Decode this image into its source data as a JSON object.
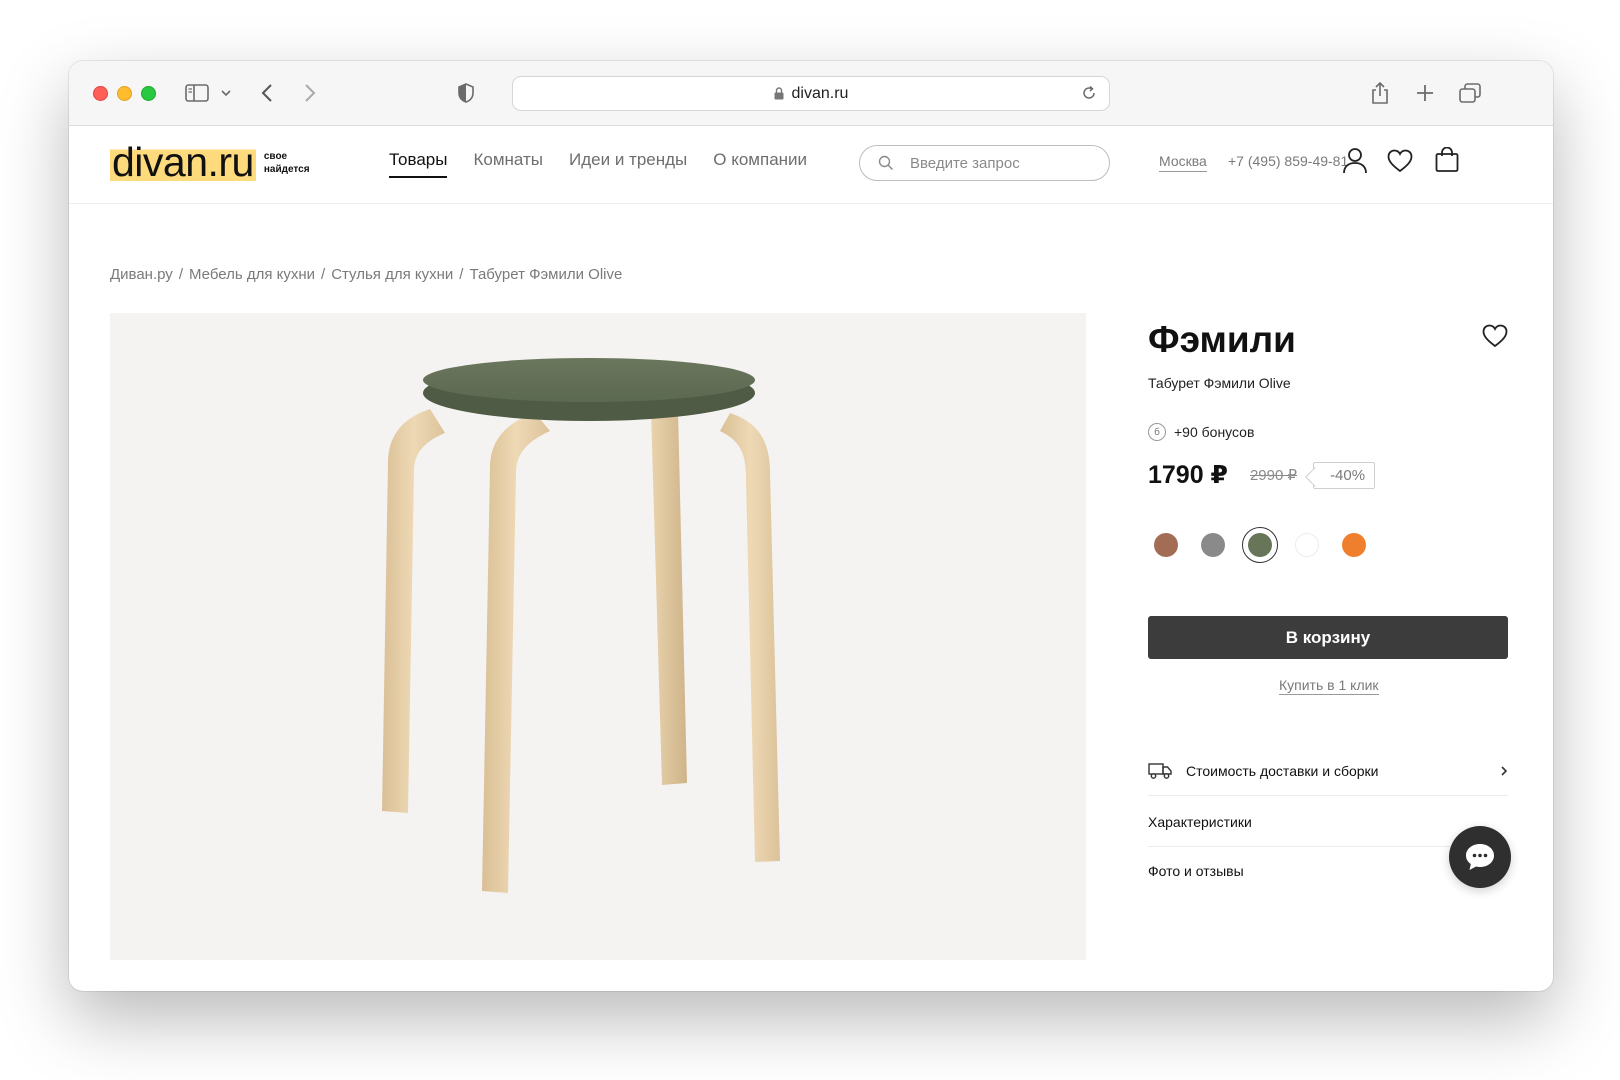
{
  "browser": {
    "url": "divan.ru"
  },
  "header": {
    "logo_text": "divan.ru",
    "logo_tagline_1": "свое",
    "logo_tagline_2": "найдется",
    "nav": [
      {
        "label": "Товары",
        "active": true
      },
      {
        "label": "Комнаты",
        "active": false
      },
      {
        "label": "Идеи и тренды",
        "active": false
      },
      {
        "label": "О компании",
        "active": false
      }
    ],
    "search_placeholder": "Введите запрос",
    "city": "Москва",
    "phone": "+7 (495) 859-49-81"
  },
  "breadcrumbs": [
    "Диван.ру",
    "Мебель для кухни",
    "Стулья для кухни",
    "Табурет Фэмили Olive"
  ],
  "product": {
    "title": "Фэмили",
    "subtitle": "Табурет Фэмили Olive",
    "bonus_icon": "б",
    "bonus": "+90 бонусов",
    "price": "1790 ₽",
    "old_price": "2990 ₽",
    "discount": "-40%",
    "swatches": [
      {
        "name": "brown",
        "color": "#a26c55",
        "selected": false
      },
      {
        "name": "gray",
        "color": "#8a8a8a",
        "selected": false
      },
      {
        "name": "olive",
        "color": "#687559",
        "selected": true
      },
      {
        "name": "white",
        "color": "#ffffff",
        "selected": false
      },
      {
        "name": "orange",
        "color": "#f07f2d",
        "selected": false
      }
    ],
    "cart_button": "В корзину",
    "one_click": "Купить в 1 клик",
    "accordion": [
      {
        "label": "Стоимость доставки и сборки"
      },
      {
        "label": "Характеристики"
      },
      {
        "label": "Фото и отзывы"
      }
    ]
  },
  "colors": {
    "logo_highlight": "#fddb7d",
    "button_dark": "#3c3c3c",
    "image_background": "#f4f3f1",
    "stool_seat": "#657258",
    "stool_wood": "#e6cfa8"
  }
}
